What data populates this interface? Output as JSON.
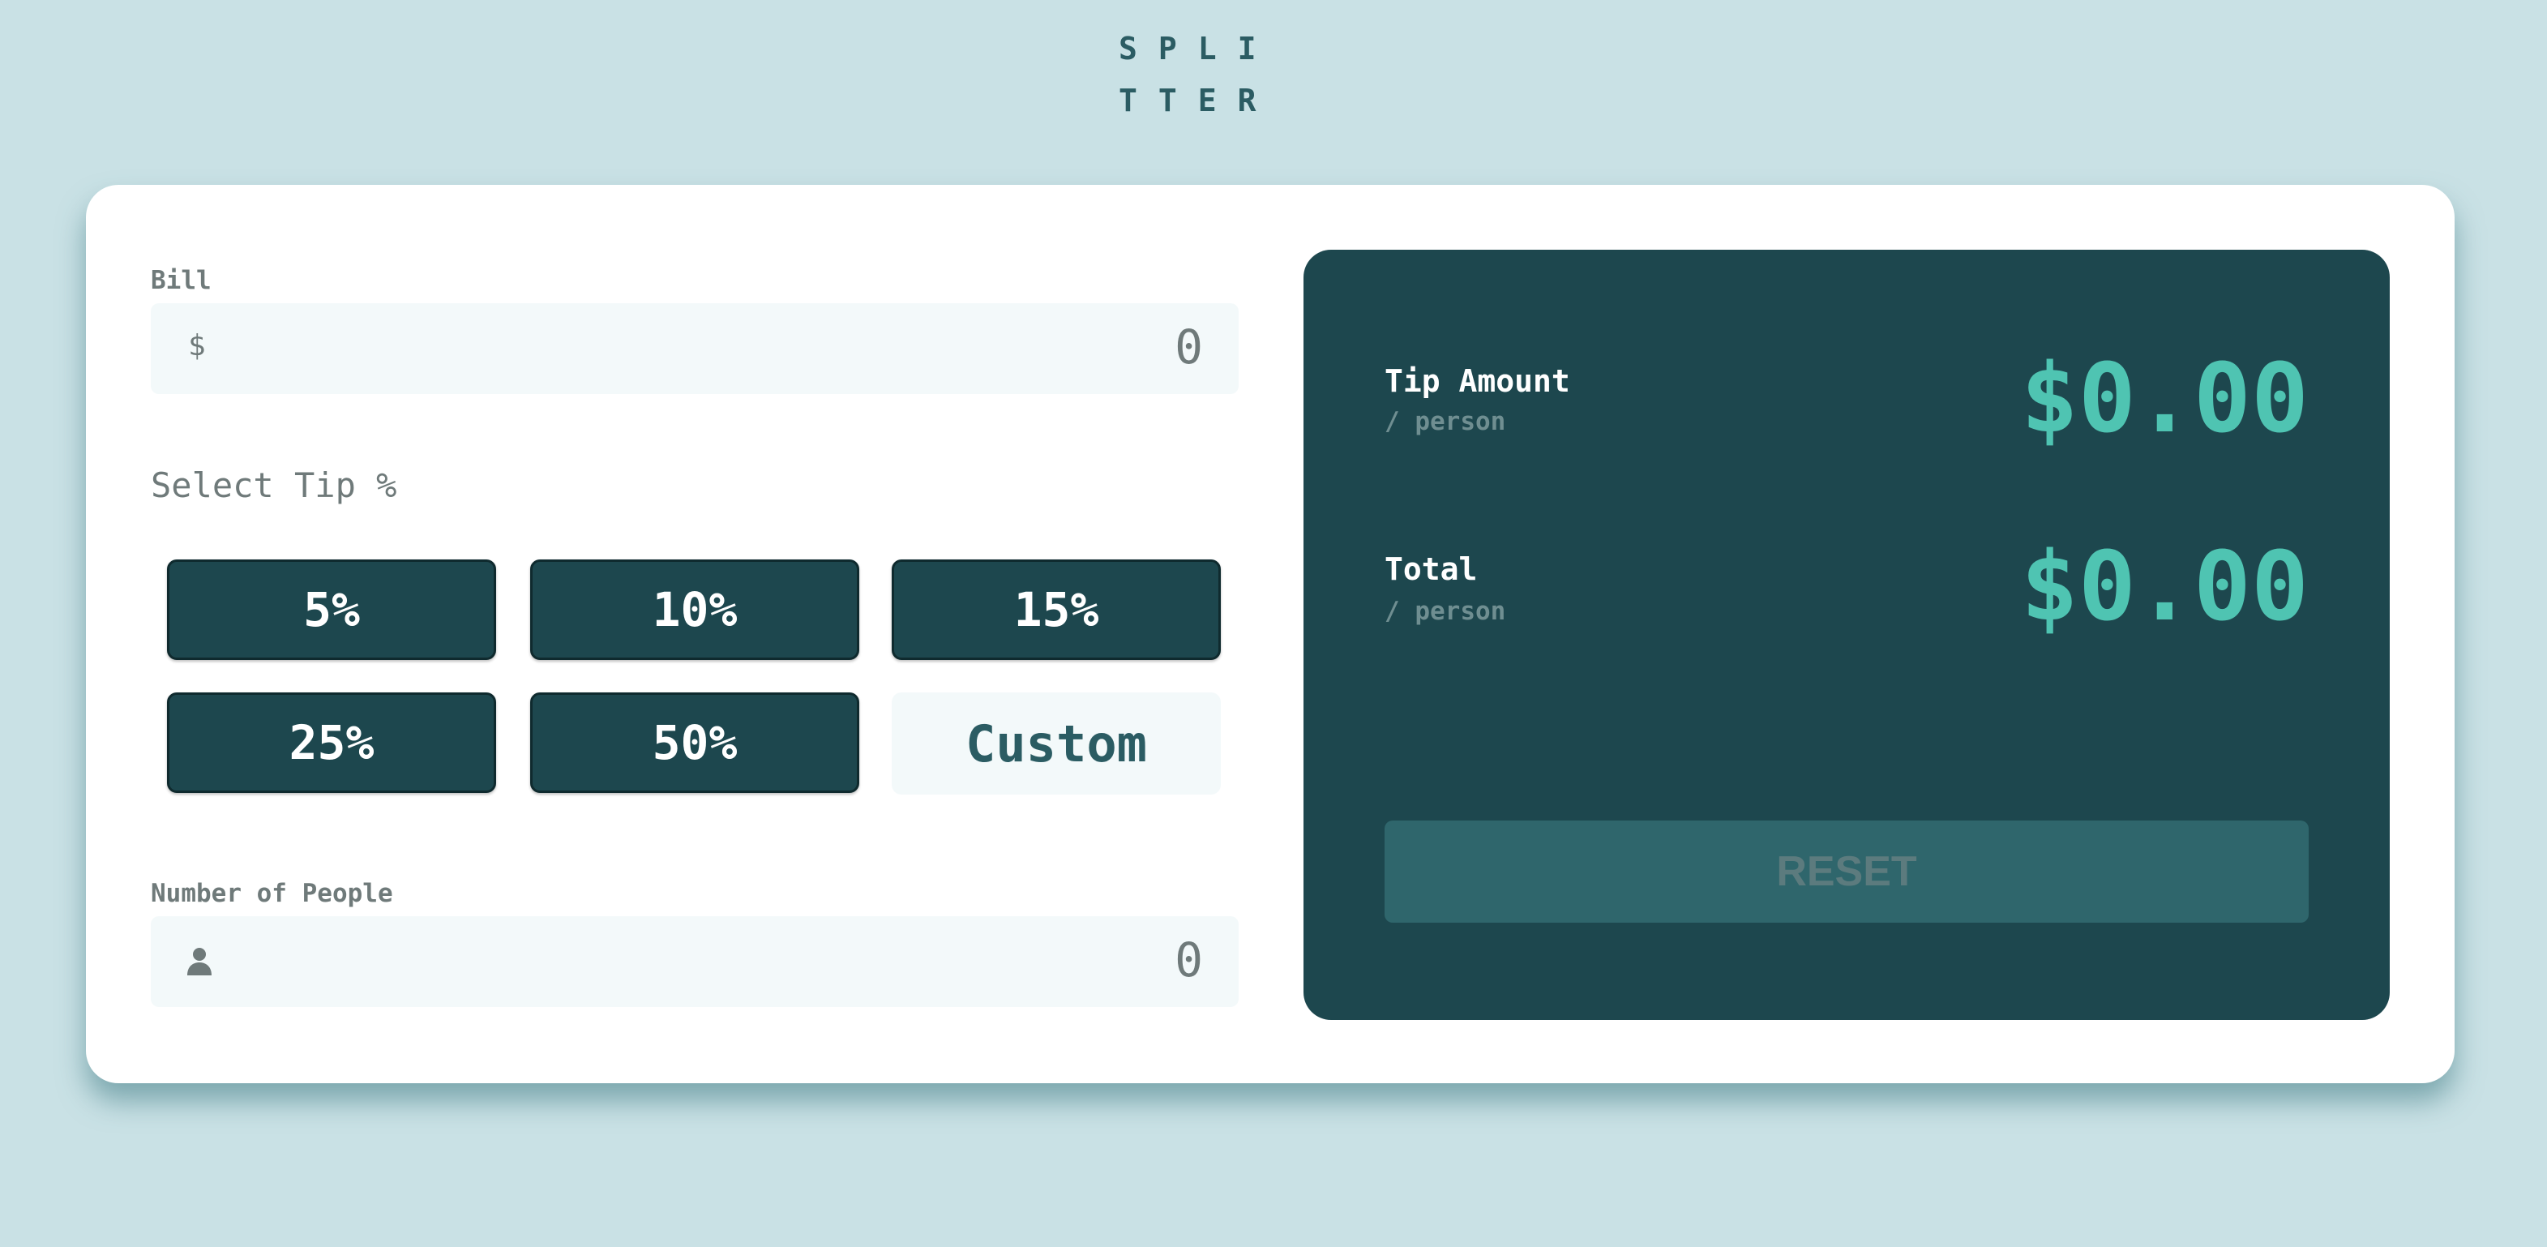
{
  "app": {
    "logo_line1": "SPLI",
    "logo_line2": "TTER"
  },
  "bill": {
    "label": "Bill",
    "prefix": "$",
    "value": "0"
  },
  "tip": {
    "heading": "Select Tip %",
    "options": [
      "5%",
      "10%",
      "15%",
      "25%",
      "50%"
    ],
    "custom_label": "Custom"
  },
  "people": {
    "label": "Number of People",
    "icon": "person-icon",
    "value": "0"
  },
  "results": {
    "tip_amount_label": "Tip Amount",
    "tip_amount_sub": "/ person",
    "tip_amount_value": "$0.00",
    "total_label": "Total",
    "total_sub": "/ person",
    "total_value": "$0.00",
    "reset_label": "RESET"
  },
  "colors": {
    "background": "#c9e1e5",
    "panel": "#1d474e",
    "accent": "#4fc4b2",
    "reset_disabled": "#2f666c"
  }
}
